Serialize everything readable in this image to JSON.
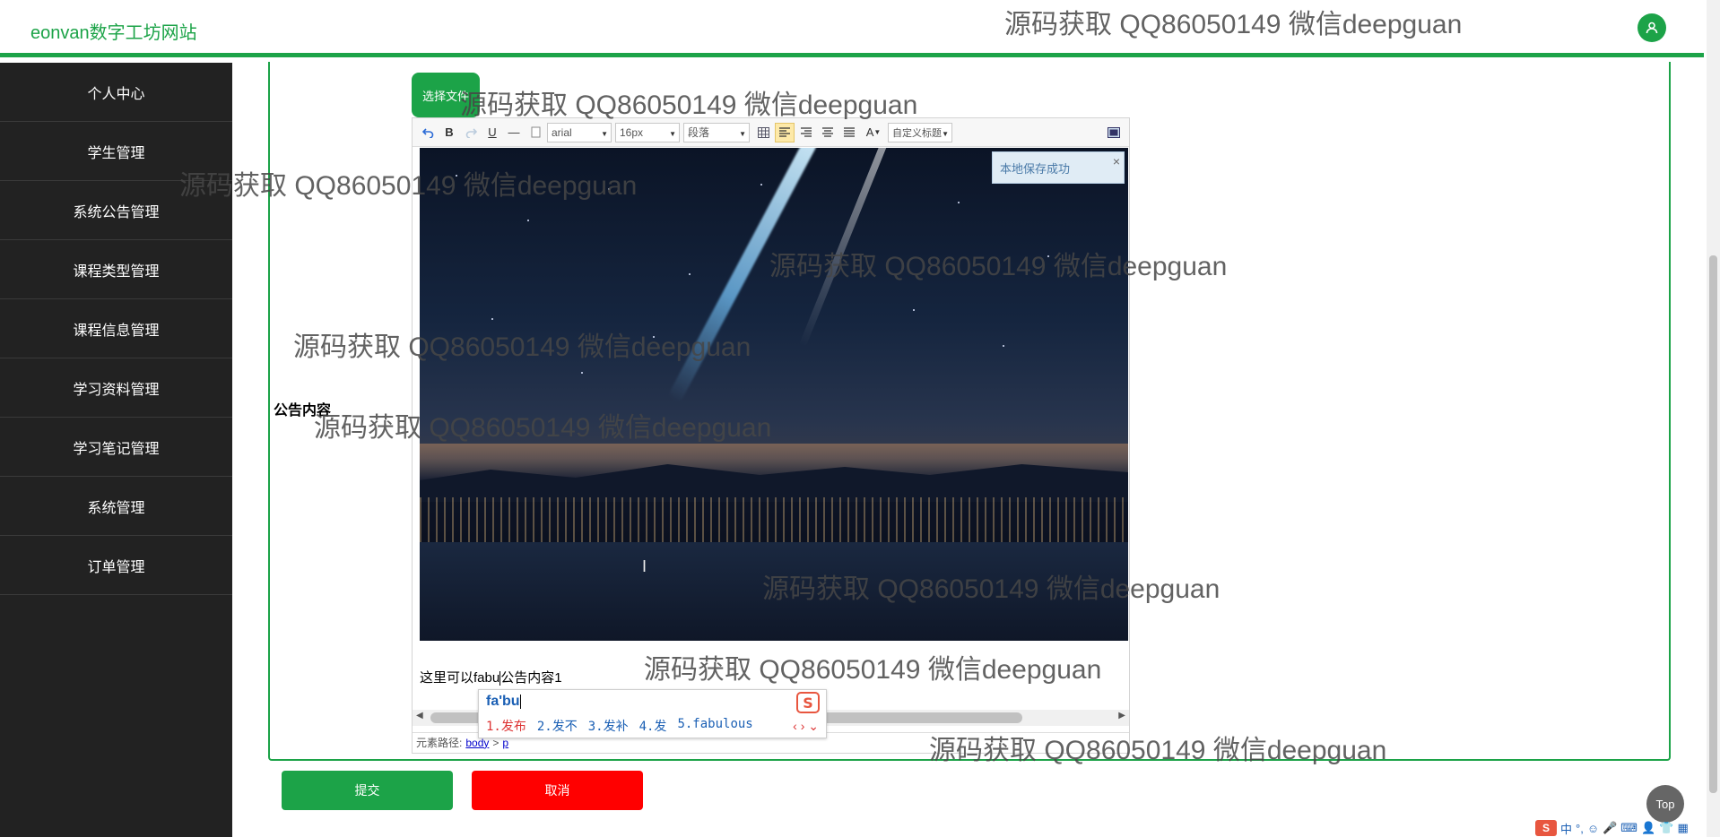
{
  "app": {
    "brand": "eonvan数字工坊网站"
  },
  "sidebar": {
    "items": [
      {
        "label": "个人中心"
      },
      {
        "label": "学生管理"
      },
      {
        "label": "系统公告管理"
      },
      {
        "label": "课程类型管理"
      },
      {
        "label": "课程信息管理"
      },
      {
        "label": "学习资料管理"
      },
      {
        "label": "学习笔记管理"
      },
      {
        "label": "系统管理"
      },
      {
        "label": "订单管理"
      }
    ]
  },
  "form": {
    "field_label": "公告内容",
    "choose_file_label": "选择文件",
    "submit_label": "提交",
    "cancel_label": "取消"
  },
  "editor": {
    "font_family": "arial",
    "font_size": "16px",
    "paragraph": "段落",
    "custom_title": "自定义标题",
    "notice": "本地保存成功",
    "notice_close": "×",
    "body_text_before": "这里可以fabu",
    "body_text_after": "公告内容1",
    "path_label": "元素路径:",
    "path_body": "body",
    "path_sep": ">",
    "path_p": "p"
  },
  "ime": {
    "pinyin": "fa'bu",
    "candidates": [
      "1.发布",
      "2.发不",
      "3.发补",
      "4.发",
      "5.fabulous"
    ],
    "nav_arrows": "‹ › ⌄",
    "logo": "S"
  },
  "watermark": {
    "text": "源码获取 QQ86050149 微信deepguan"
  },
  "page": {
    "top_label": "Top"
  },
  "taskbar": {
    "ime_logo": "S",
    "ime_mode": "中",
    "ime_punct": "°,"
  },
  "colors": {
    "brand_green": "#1ca348",
    "sidebar_bg": "#222222",
    "cancel_red": "#ff0000"
  }
}
